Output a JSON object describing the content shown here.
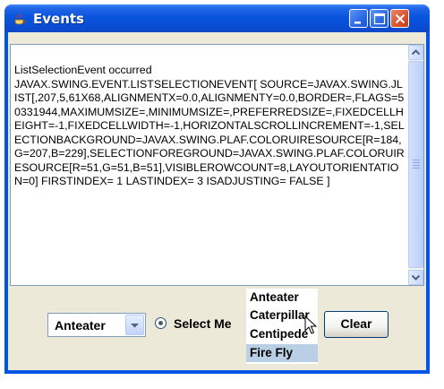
{
  "window": {
    "title": "Events",
    "app_icon": "java-cup-icon",
    "controls": [
      "minimize-icon",
      "maximize-icon",
      "close-icon"
    ]
  },
  "event_log": {
    "heading": "ListSelectionEvent occurred",
    "body": "JAVAX.SWING.EVENT.LISTSELECTIONEVENT[ SOURCE=JAVAX.SWING.JLIST[,207,5,61X68,ALIGNMENTX=0.0,ALIGNMENTY=0.0,BORDER=,FLAGS=50331944,MAXIMUMSIZE=,MINIMUMSIZE=,PREFERREDSIZE=,FIXEDCELLHEIGHT=-1,FIXEDCELLWIDTH=-1,HORIZONTALSCROLLINCREMENT=-1,SELECTIONBACKGROUND=JAVAX.SWING.PLAF.COLORUIRESOURCE[R=184,G=207,B=229],SELECTIONFOREGROUND=JAVAX.SWING.PLAF.COLORUIRESOURCE[R=51,G=51,B=51],VISIBLEROWCOUNT=8,LAYOUTORIENTATION=0] FIRSTINDEX= 1 LASTINDEX= 3 ISADJUSTING= FALSE ]"
  },
  "controls": {
    "combo_value": "Anteater",
    "radio_label": "Select Me",
    "radio_checked": true,
    "list_items": [
      {
        "label": "Anteater",
        "selected": false
      },
      {
        "label": "Caterpillar",
        "selected": false
      },
      {
        "label": "Centipede",
        "selected": false
      },
      {
        "label": "Fire Fly",
        "selected": true
      }
    ],
    "clear_label": "Clear"
  },
  "colors": {
    "titlebar": "#0854dc",
    "selection_background": "#b8cfe5",
    "panel": "#ece9d8"
  }
}
